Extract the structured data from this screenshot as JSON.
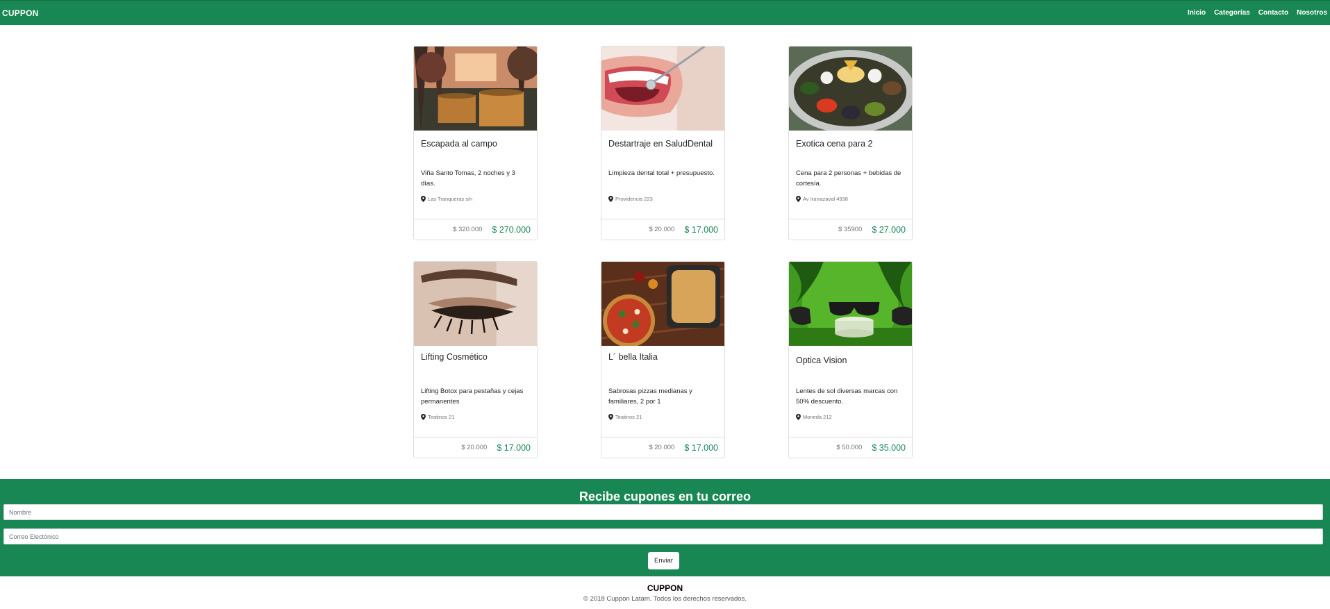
{
  "nav": {
    "brand": "CUPPON",
    "links": [
      "Inicio",
      "Categorías",
      "Contacto",
      "Nosotros"
    ]
  },
  "cards": [
    {
      "title": "Escapada al campo",
      "description": "Viña Santo Tomas, 2 noches y 3 días.",
      "location": "Las Tranqueras s/n",
      "old_price": "$ 320.000",
      "new_price": "$ 270.000",
      "image": "hot-tubs-forest-image"
    },
    {
      "title": "Destartraje en SaludDental",
      "description": "Limpieza dental total + presupuesto.",
      "location": "Providencia 223",
      "old_price": "$ 20.000",
      "new_price": "$ 17.000",
      "image": "dental-smile-image"
    },
    {
      "title": "Exotica cena para 2",
      "description": "Cena para 2 personas + bebidas de cortesía.",
      "location": "Av Irarrazaval 4938",
      "old_price": "$ 35900",
      "new_price": "$ 27.000",
      "image": "food-platter-image"
    },
    {
      "title": "Lifting Cosmético",
      "description": "Lifting Botox para pestañas y cejas permanentes",
      "location": "Teatinos 21",
      "old_price": "$ 20.000",
      "new_price": "$ 17.000",
      "image": "eyelash-image"
    },
    {
      "title": "L´ bella Italia",
      "description": "Sabrosas pizzas medianas y familiares, 2 por 1",
      "location": "Teatinos 21",
      "old_price": "$ 20.000",
      "new_price": "$ 17.000",
      "image": "pizza-image"
    },
    {
      "title": "Optica Vision",
      "description": "Lentes de sol diversas marcas con 50% descuento.",
      "location": "Moneda 212",
      "old_price": "$ 50.000",
      "new_price": "$ 35.000",
      "image": "sunglasses-image"
    }
  ],
  "subscribe": {
    "title": "Recibe cupones en tu correo",
    "name_placeholder": "Nombre",
    "email_placeholder": "Correo Electónico",
    "button": "Enviar"
  },
  "footer": {
    "title": "CUPPON",
    "copyright": "© 2018 Cuppon Latam. Todos los derechos reservados."
  },
  "colors": {
    "brand_green": "#198754",
    "white": "#ffffff"
  }
}
